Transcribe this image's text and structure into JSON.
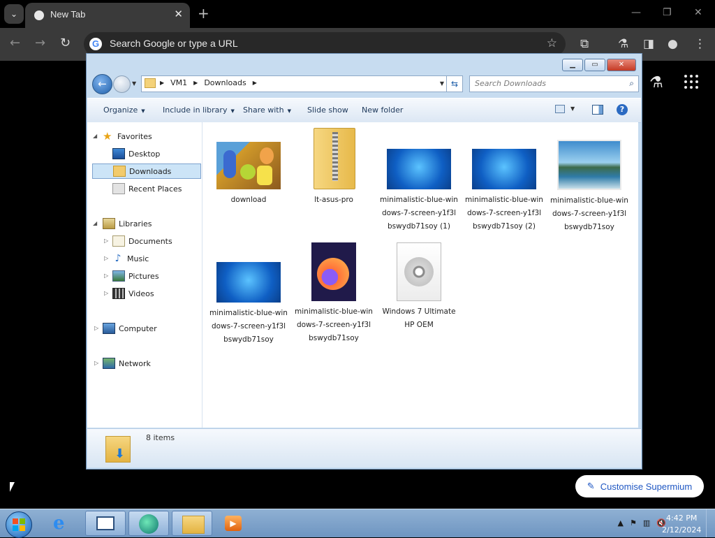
{
  "browser": {
    "tab_title": "New Tab",
    "omnibox_placeholder": "Search Google or type a URL",
    "customise_label": "Customise Supermium"
  },
  "explorer": {
    "breadcrumbs": [
      "VM1",
      "Downloads"
    ],
    "search_placeholder": "Search Downloads",
    "commands": {
      "organize": "Organize",
      "include_in_library": "Include in library",
      "share_with": "Share with",
      "slide_show": "Slide show",
      "new_folder": "New folder"
    },
    "nav": {
      "favorites": "Favorites",
      "desktop": "Desktop",
      "downloads": "Downloads",
      "recent_places": "Recent Places",
      "libraries": "Libraries",
      "documents": "Documents",
      "music": "Music",
      "pictures": "Pictures",
      "videos": "Videos",
      "computer": "Computer",
      "network": "Network"
    },
    "files": [
      {
        "name": "download",
        "type": "image-cartoon"
      },
      {
        "name": "lt-asus-pro",
        "type": "zip-folder"
      },
      {
        "name": "minimalistic-blue-windows-7-screen-y1f3lbswydb71soy (1)",
        "type": "image-win7"
      },
      {
        "name": "minimalistic-blue-windows-7-screen-y1f3lbswydb71soy (2)",
        "type": "image-win7"
      },
      {
        "name": "minimalistic-blue-windows-7-screen-y1f3lbswydb71soy",
        "type": "image-landscape"
      },
      {
        "name": "minimalistic-blue-windows-7-screen-y1f3lbswydb71soy",
        "type": "image-win7"
      },
      {
        "name": "minimalistic-blue-windows-7-screen-y1f3lbswydb71soy",
        "type": "firefox-html"
      },
      {
        "name": "Windows 7 Ultimate HP OEM",
        "type": "disc-image"
      }
    ],
    "status_count": "8 items"
  },
  "taskbar": {
    "time": "4:42 PM",
    "date": "2/12/2024"
  }
}
